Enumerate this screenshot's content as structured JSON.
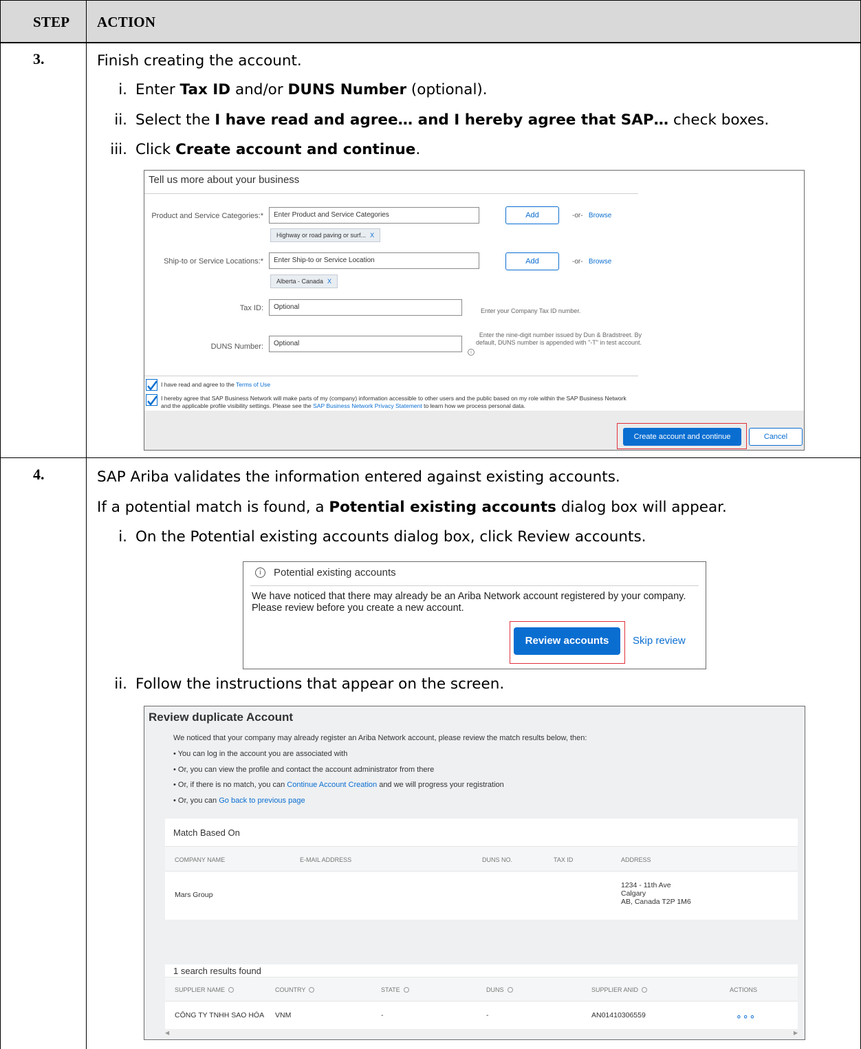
{
  "header": {
    "step_label": "STEP",
    "action_label": "ACTION"
  },
  "step3": {
    "number": "3.",
    "intro": "Finish creating the account.",
    "items": [
      {
        "roman": "i.",
        "pre": "Enter ",
        "b1": "Tax ID",
        "mid": " and/or ",
        "b2": "DUNS Number",
        "post": " (optional)."
      },
      {
        "roman": "ii.",
        "pre": "Select the ",
        "b1": "I have read and agree… and I hereby agree that SAP…",
        "post": " check boxes."
      },
      {
        "roman": "iii.",
        "pre": "Click ",
        "b1": "Create account and continue",
        "post": "."
      }
    ]
  },
  "form": {
    "title": "Tell us more about your business",
    "categories_label": "Product and Service Categories:*",
    "categories_placeholder": "Enter Product and Service Categories",
    "categories_chip": "Highway or road paving or surf...",
    "locations_label": "Ship-to or Service Locations:*",
    "locations_placeholder": "Enter Ship-to or Service Location",
    "locations_chip": "Alberta - Canada",
    "chip_remove": "X",
    "add_label": "Add",
    "or_label": "-or-",
    "browse_label": "Browse",
    "tax_label": "Tax ID:",
    "tax_placeholder": "Optional",
    "tax_hint": "Enter your Company Tax ID number.",
    "duns_label": "DUNS Number:",
    "duns_placeholder": "Optional",
    "duns_hint_1": "Enter the nine-digit number issued by Dun & Bradstreet. By",
    "duns_hint_2": "default, DUNS number is appended with \"-T\" in test account.",
    "terms_pre": "I have read and agree to the ",
    "terms_link": "Terms of Use",
    "privacy_line1": "I hereby agree that SAP Business Network will make parts of my (company) information accessible to other users and the public based on my role within the SAP Business Network",
    "privacy_pre": "and the applicable profile visibility settings. Please see the ",
    "privacy_link": "SAP Business Network Privacy Statement",
    "privacy_post": " to learn how we process personal data.",
    "create_button": "Create account and continue",
    "cancel_button": "Cancel"
  },
  "step4": {
    "number": "4.",
    "line1": "SAP Ariba validates the information entered against existing accounts.",
    "line2_pre": "If a potential match is found, a ",
    "line2_bold": "Potential existing accounts",
    "line2_post": " dialog box will appear.",
    "item1_roman": "i.",
    "item1": "On the Potential existing accounts dialog box, click Review accounts.",
    "item2_roman": "ii.",
    "item2": "Follow the instructions that appear on the screen."
  },
  "dialog": {
    "title": "Potential existing accounts",
    "body": "We have noticed that there may already be an Ariba Network account registered by your company. Please review before you create a new account.",
    "review_button": "Review accounts",
    "skip_link": "Skip review"
  },
  "review": {
    "title": "Review duplicate Account",
    "intro": "We noticed that your company may already register an Ariba Network account, please review the match results below, then:",
    "bullet1": "• You can log in the account you are associated with",
    "bullet2": "• Or, you can view the profile and contact the account administrator from there",
    "bullet3_pre": "• Or, if there is no match, you can ",
    "bullet3_link": "Continue Account Creation",
    "bullet3_post": " and we will progress your registration",
    "bullet4_pre": "• Or, you can ",
    "bullet4_link": "Go back to previous page",
    "match_title": "Match Based On",
    "match_headers": [
      "COMPANY NAME",
      "E-MAIL ADDRESS",
      "DUNS NO.",
      "TAX ID",
      "ADDRESS"
    ],
    "match_company": "Mars Group",
    "match_address_1": "1234 - 11th Ave",
    "match_address_2": "Calgary",
    "match_address_3": "AB, Canada T2P 1M6",
    "results_title": "1 search results found",
    "results_headers": [
      "SUPPLIER NAME",
      "COUNTRY",
      "STATE",
      "DUNS",
      "SUPPLIER ANID",
      "ACTIONS"
    ],
    "result_row": [
      "CÔNG TY TNHH SAO HÓA",
      "VNM",
      "-",
      "-",
      "AN01410306559"
    ],
    "actions_glyph": "∘∘∘"
  },
  "colors": {
    "accent": "#0a6ed1",
    "highlight": "#e0303a",
    "header_bg": "#d9d9d9"
  }
}
